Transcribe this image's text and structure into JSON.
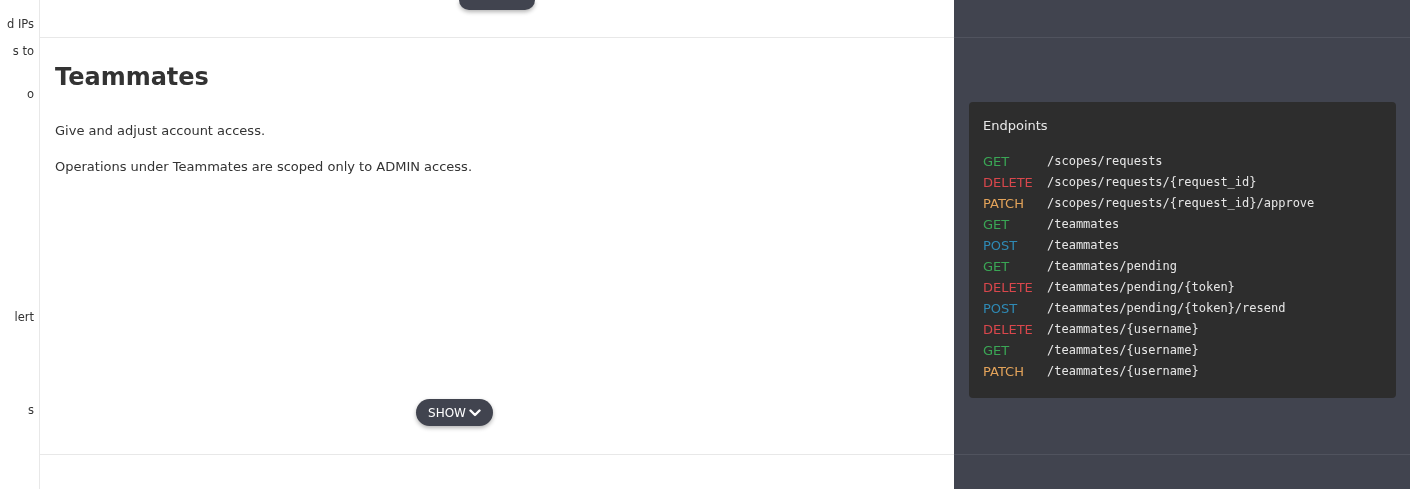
{
  "sidebar": {
    "items": [
      {
        "label": "d IPs"
      },
      {
        "label": "s to"
      },
      {
        "label": "o"
      },
      {
        "label": "lert"
      },
      {
        "label": "s"
      }
    ]
  },
  "section": {
    "title": "Teammates",
    "paragraphs": [
      "Give and adjust account access.",
      "Operations under Teammates are scoped only to ADMIN access."
    ],
    "toggle_label": "SHOW"
  },
  "endpoints": {
    "title": "Endpoints",
    "items": [
      {
        "method": "GET",
        "color": "#3aa655",
        "path": "/scopes/requests"
      },
      {
        "method": "DELETE",
        "color": "#d9474c",
        "path": "/scopes/requests/{request_id}"
      },
      {
        "method": "PATCH",
        "color": "#e3a35a",
        "path": "/scopes/requests/{request_id}/approve"
      },
      {
        "method": "GET",
        "color": "#3aa655",
        "path": "/teammates"
      },
      {
        "method": "POST",
        "color": "#2f8ab5",
        "path": "/teammates"
      },
      {
        "method": "GET",
        "color": "#3aa655",
        "path": "/teammates/pending"
      },
      {
        "method": "DELETE",
        "color": "#d9474c",
        "path": "/teammates/pending/{token}"
      },
      {
        "method": "POST",
        "color": "#2f8ab5",
        "path": "/teammates/pending/{token}/resend"
      },
      {
        "method": "DELETE",
        "color": "#d9474c",
        "path": "/teammates/{username}"
      },
      {
        "method": "GET",
        "color": "#3aa655",
        "path": "/teammates/{username}"
      },
      {
        "method": "PATCH",
        "color": "#e3a35a",
        "path": "/teammates/{username}"
      }
    ]
  }
}
